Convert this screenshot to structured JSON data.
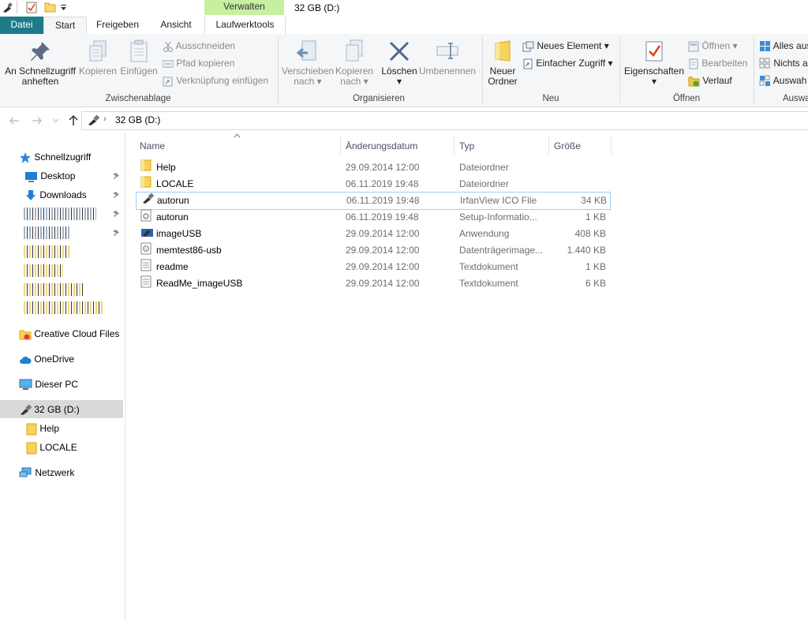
{
  "window": {
    "title": "32 GB (D:)",
    "context_tab": "Verwalten"
  },
  "tabs": [
    "Datei",
    "Start",
    "Freigeben",
    "Ansicht",
    "Laufwerktools"
  ],
  "ribbon": {
    "clipboard": {
      "label": "Zwischenablage",
      "pin_line1": "An Schnellzugriff",
      "pin_line2": "anheften",
      "copy": "Kopieren",
      "paste": "Einfügen",
      "cut": "Ausschneiden",
      "copy_path": "Pfad kopieren",
      "paste_shortcut": "Verknüpfung einfügen"
    },
    "organize": {
      "label": "Organisieren",
      "move_line1": "Verschieben",
      "move_line2": "nach",
      "copyto_line1": "Kopieren",
      "copyto_line2": "nach",
      "delete": "Löschen",
      "rename": "Umbenennen"
    },
    "new": {
      "label": "Neu",
      "folder_line1": "Neuer",
      "folder_line2": "Ordner",
      "new_item": "Neues Element",
      "easy_access": "Einfacher Zugriff"
    },
    "open": {
      "label": "Öffnen",
      "properties": "Eigenschaften",
      "open": "Öffnen",
      "edit": "Bearbeiten",
      "history": "Verlauf"
    },
    "select": {
      "label": "Auswa",
      "select_all": "Alles aus",
      "select_none": "Nichts a",
      "invert": "Auswah"
    }
  },
  "address": {
    "path": "32 GB (D:)"
  },
  "nav": {
    "quick_access": "Schnellzugriff",
    "desktop": "Desktop",
    "downloads": "Downloads",
    "creative_cloud": "Creative Cloud Files",
    "onedrive": "OneDrive",
    "this_pc": "Dieser PC",
    "drive": "32 GB (D:)",
    "drive_children": [
      "Help",
      "LOCALE"
    ],
    "network": "Netzwerk"
  },
  "columns": {
    "name": "Name",
    "date": "Änderungsdatum",
    "type": "Typ",
    "size": "Größe"
  },
  "files": [
    {
      "name": "Help",
      "date": "29.09.2014 12:00",
      "type": "Dateiordner",
      "size": "",
      "icon": "folder-icon"
    },
    {
      "name": "LOCALE",
      "date": "06.11.2019 19:48",
      "type": "Dateiordner",
      "size": "",
      "icon": "folder-icon"
    },
    {
      "name": "autorun",
      "date": "06.11.2019 19:48",
      "type": "IrfanView ICO File",
      "size": "34 KB",
      "icon": "usb-drive-icon"
    },
    {
      "name": "autorun",
      "date": "06.11.2019 19:48",
      "type": "Setup-Informatio...",
      "size": "1 KB",
      "icon": "settings-file-icon"
    },
    {
      "name": "imageUSB",
      "date": "29.09.2014 12:00",
      "type": "Anwendung",
      "size": "408 KB",
      "icon": "application-icon"
    },
    {
      "name": "memtest86-usb",
      "date": "29.09.2014 12:00",
      "type": "Datenträgerimage...",
      "size": "1.440 KB",
      "icon": "disk-image-icon"
    },
    {
      "name": "readme",
      "date": "29.09.2014 12:00",
      "type": "Textdokument",
      "size": "1 KB",
      "icon": "text-file-icon"
    },
    {
      "name": "ReadMe_imageUSB",
      "date": "29.09.2014 12:00",
      "type": "Textdokument",
      "size": "6 KB",
      "icon": "text-file-icon"
    }
  ],
  "colors": {
    "file_tab": "#1d7b8a",
    "context_tab": "#c6efa0",
    "selected_nav": "#d9d9d9",
    "row_hover_border": "#99d1ff"
  }
}
